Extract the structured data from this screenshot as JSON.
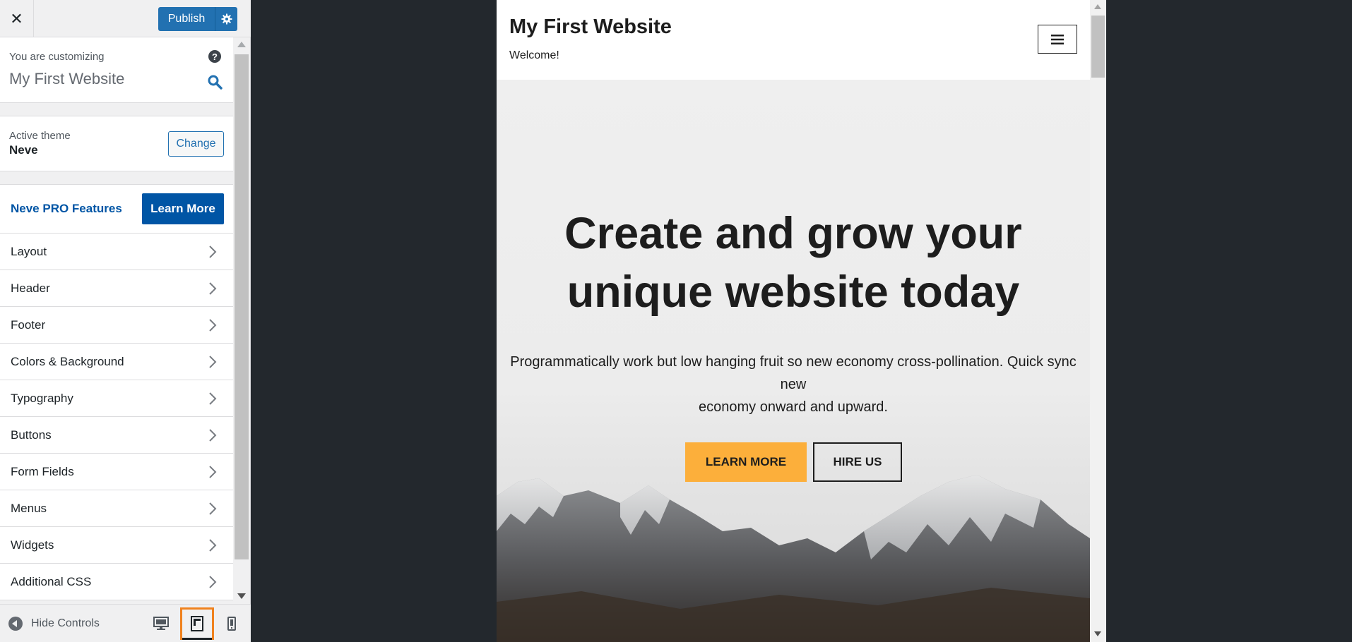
{
  "topbar": {
    "close_icon": "close-icon",
    "publish_label": "Publish",
    "settings_icon": "gear-icon",
    "accent_color": "#2271b1"
  },
  "customizing": {
    "label": "You are customizing",
    "site_name": "My First Website",
    "help_glyph": "?"
  },
  "theme": {
    "label": "Active theme",
    "name": "Neve",
    "change_label": "Change"
  },
  "pro": {
    "label": "Neve PRO Features",
    "button_label": "Learn More",
    "color": "#0055a5"
  },
  "menu": {
    "items": [
      {
        "label": "Layout"
      },
      {
        "label": "Header"
      },
      {
        "label": "Footer"
      },
      {
        "label": "Colors & Background"
      },
      {
        "label": "Typography"
      },
      {
        "label": "Buttons"
      },
      {
        "label": "Form Fields"
      },
      {
        "label": "Menus"
      },
      {
        "label": "Widgets"
      },
      {
        "label": "Additional CSS"
      }
    ]
  },
  "footer": {
    "hide_controls_label": "Hide Controls",
    "devices": [
      "desktop-icon",
      "tablet-icon",
      "mobile-icon"
    ],
    "active_device": "tablet",
    "highlight_color": "#f0821e"
  },
  "preview": {
    "site_title": "My First Website",
    "tagline": "Welcome!",
    "hero_title_line1": "Create and grow your",
    "hero_title_line2": "unique website today",
    "hero_text_line1": "Programmatically work but low hanging fruit so new economy cross-pollination. Quick sync",
    "hero_text_line2": "new",
    "hero_text_line3": "economy onward and upward.",
    "primary_button": "LEARN MORE",
    "secondary_button": "HIRE US",
    "primary_color": "#fcaf3b"
  }
}
